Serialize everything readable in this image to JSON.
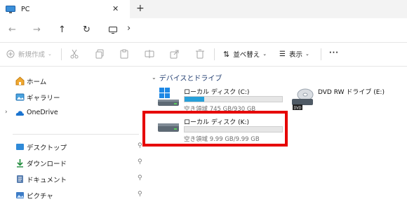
{
  "window": {
    "tab_title": "PC",
    "close_glyph": "✕",
    "new_tab_glyph": "+"
  },
  "nav": {
    "back_glyph": "←",
    "forward_glyph": "→",
    "up_glyph": "↑",
    "refresh_glyph": "↻",
    "breadcrumb_sep": "›"
  },
  "toolbar": {
    "new_label": "新規作成",
    "sort_label": "並べ替え",
    "view_label": "表示",
    "more_label": "···"
  },
  "sidebar": {
    "items": [
      {
        "label": "ホーム",
        "icon": "home-icon"
      },
      {
        "label": "ギャラリー",
        "icon": "gallery-icon"
      },
      {
        "label": "OneDrive",
        "icon": "onedrive-icon"
      },
      {
        "label": "デスクトップ",
        "icon": "desktop-icon"
      },
      {
        "label": "ダウンロード",
        "icon": "download-icon"
      },
      {
        "label": "ドキュメント",
        "icon": "documents-icon"
      },
      {
        "label": "ピクチャ",
        "icon": "pictures-icon"
      }
    ],
    "pin_glyph": "📌",
    "expand_glyph": "›"
  },
  "content": {
    "group_title": "デバイスとドライブ",
    "drives": [
      {
        "name": "ローカル ディスク (C:)",
        "free_text": "空き領域 745 GB/930 GB",
        "used_fraction": 0.2
      },
      {
        "name": "DVD RW ドライブ (E:)",
        "free_text": ""
      },
      {
        "name": "ローカル ディスク (K:)",
        "free_text": "空き領域 9.99 GB/9.99 GB",
        "used_fraction": 0.0
      }
    ]
  },
  "colors": {
    "accent": "#26a0da",
    "highlight": "#e60000",
    "group_header": "#1f3b6e"
  }
}
